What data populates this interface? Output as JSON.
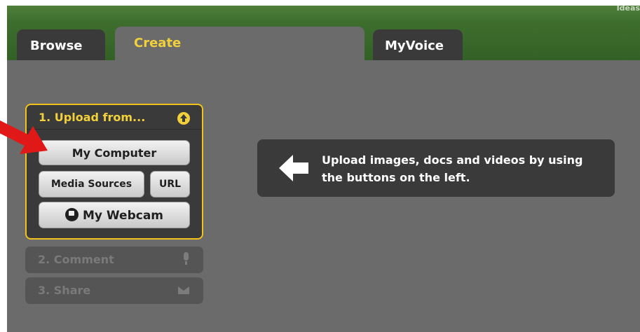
{
  "header": {
    "brand_text": "Ideas"
  },
  "tabs": [
    {
      "label": "Browse"
    },
    {
      "label": "Create"
    },
    {
      "label": "MyVoice"
    }
  ],
  "upload_panel": {
    "title": "1. Upload from...",
    "buttons": {
      "my_computer": "My Computer",
      "media_sources": "Media Sources",
      "url": "URL",
      "my_webcam": "My Webcam"
    }
  },
  "steps": {
    "comment": "2. Comment",
    "share": "3. Share"
  },
  "info_message": "Upload images, docs and videos by using the buttons on the left.",
  "colors": {
    "accent_yellow": "#f2d03b",
    "header_green": "#3e6e2e",
    "panel_dark": "#3a3a3a",
    "pointer_red": "#e01818"
  },
  "icons": [
    "up-arrow-circle-icon",
    "webcam-icon",
    "microphone-icon",
    "envelope-icon",
    "left-arrow-icon",
    "red-pointer-arrow-icon"
  ]
}
